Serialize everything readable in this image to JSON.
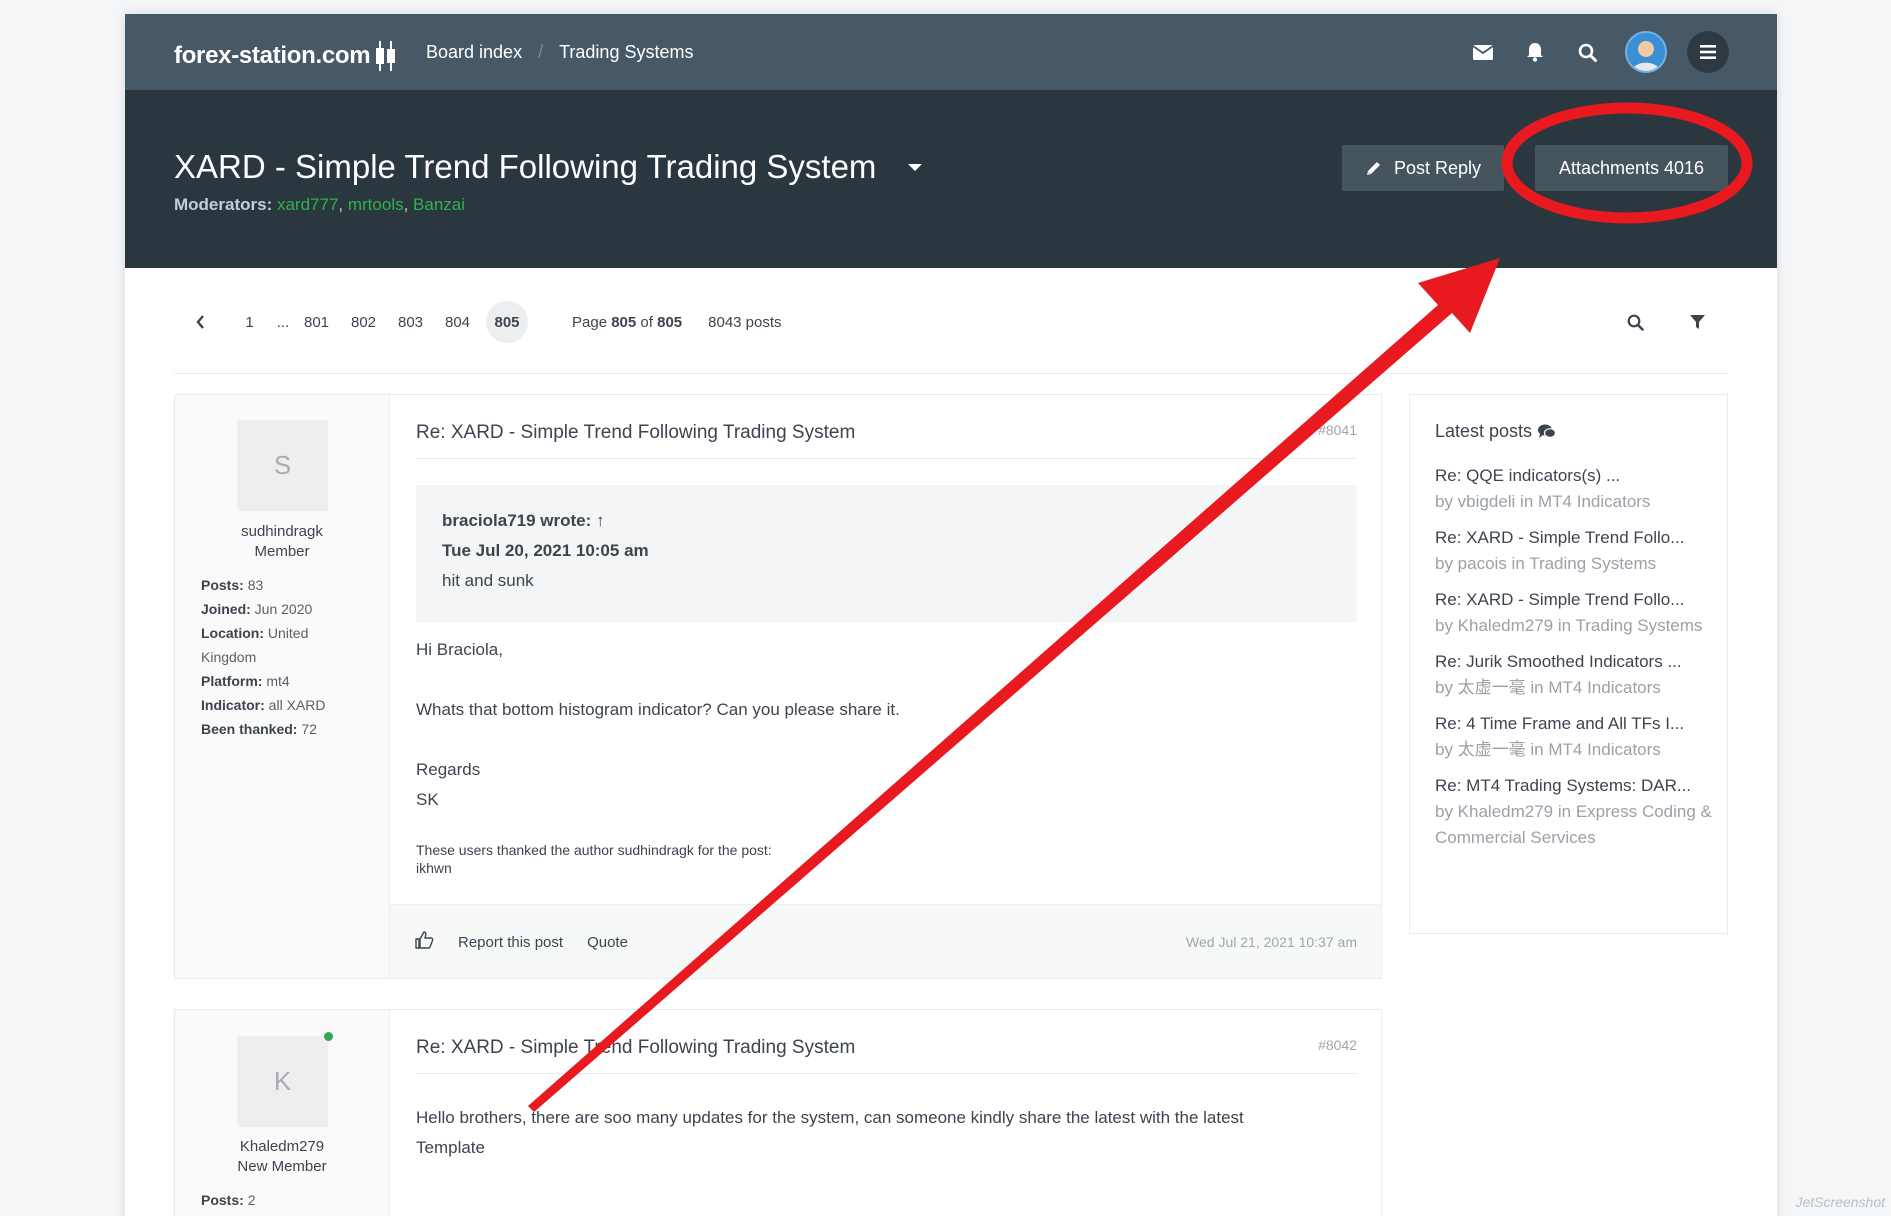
{
  "navbar": {
    "logo_text": "forex-station.com",
    "breadcrumb": [
      {
        "label": "Board index"
      },
      {
        "label": "Trading Systems"
      }
    ],
    "icons": [
      "envelope-icon",
      "bell-icon",
      "search-icon",
      "user-avatar",
      "menu-icon"
    ]
  },
  "header": {
    "title": "XARD - Simple Trend Following Trading System",
    "moderators_label": "Moderators:",
    "moderators": [
      "xard777",
      "mrtools",
      "Banzai"
    ],
    "post_reply_label": "Post Reply",
    "attachments_label": "Attachments 4016"
  },
  "pagination": {
    "pages": [
      "1",
      "...",
      "801",
      "802",
      "803",
      "804"
    ],
    "current": "805",
    "page_prefix": "Page",
    "page_current": "805",
    "page_of": "of",
    "page_total": "805",
    "posts_count": "8043 posts"
  },
  "posts": [
    {
      "avatar_letter": "S",
      "username": "sudhindragk",
      "rank": "Member",
      "details": [
        {
          "label": "Posts:",
          "value": "83"
        },
        {
          "label": "Joined:",
          "value": "Jun 2020"
        },
        {
          "label": "Location:",
          "value": "United Kingdom"
        },
        {
          "label": "Platform:",
          "value": "mt4"
        },
        {
          "label": "Indicator:",
          "value": "all XARD"
        },
        {
          "label": "Been thanked:",
          "value": "72"
        }
      ],
      "title": "Re: XARD - Simple Trend Following Trading System",
      "number": "#8041",
      "quote": {
        "author": "braciola719 wrote: ↑",
        "date": "Tue Jul 20, 2021 10:05 am",
        "text": "hit and sunk"
      },
      "content": [
        "Hi Braciola,",
        "",
        "Whats that bottom histogram indicator? Can you please share it.",
        "",
        "Regards",
        "SK"
      ],
      "thanks_label": "These users thanked the author sudhindragk for the post:",
      "thanks_users": "ikhwn",
      "report_label": "Report this post",
      "quote_label": "Quote",
      "date": "Wed Jul 21, 2021 10:37 am"
    },
    {
      "avatar_letter": "K",
      "username": "Khaledm279",
      "rank": "New Member",
      "details": [
        {
          "label": "Posts:",
          "value": "2"
        }
      ],
      "title": "Re: XARD - Simple Trend Following Trading System",
      "number": "#8042",
      "content": [
        "Hello brothers, there are soo many updates for the system, can someone kindly share the latest with the latest Template"
      ]
    }
  ],
  "sidebar": {
    "title": "Latest posts",
    "items": [
      {
        "title": "Re: QQE indicators(s) ...",
        "meta": "by vbigdeli in MT4 Indicators"
      },
      {
        "title": "Re: XARD - Simple Trend Follo...",
        "meta": "by pacois in Trading Systems"
      },
      {
        "title": "Re: XARD - Simple Trend Follo...",
        "meta": "by Khaledm279 in Trading Systems"
      },
      {
        "title": "Re: Jurik Smoothed Indicators ...",
        "meta": "by 太虚一毫 in MT4 Indicators"
      },
      {
        "title": "Re: 4 Time Frame and All TFs I...",
        "meta": "by 太虚一毫 in MT4 Indicators"
      },
      {
        "title": "Re: MT4 Trading Systems: DAR...",
        "meta": "by Khaledm279 in Express Coding & Commercial Services"
      }
    ]
  },
  "watermark": "JetScreenshot",
  "colors": {
    "navbar": "#475966",
    "header": "#2b373f",
    "moderator_link": "#2fb24a",
    "annotation": "#e8191f"
  }
}
